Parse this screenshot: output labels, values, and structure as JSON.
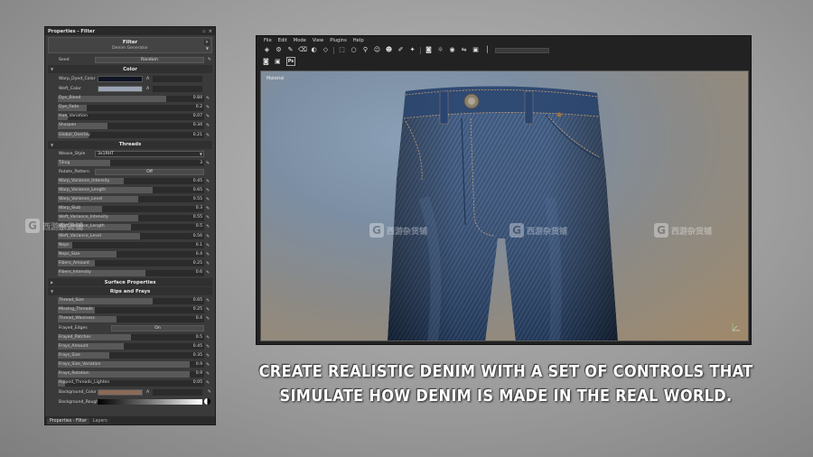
{
  "panel": {
    "title": "Properties - Filter",
    "filter_title": "Filter",
    "filter_name": "Denim Generator",
    "seed_label": "Seed",
    "seed_button": "Random",
    "sections": {
      "color": "Color",
      "threads": "Threads",
      "surface": "Surface Properties",
      "rips": "Rips and Frays"
    },
    "color_rows": [
      {
        "label": "Warp_Dyed_Color",
        "swatch": "#0f1424",
        "alpha": "A"
      },
      {
        "label": "Weft_Color",
        "swatch": "#9aa4b4",
        "alpha": "A"
      }
    ],
    "color_sliders": [
      {
        "label": "Dye_Bleed",
        "value": "0.84",
        "fill": 0.74
      },
      {
        "label": "Dye_Fade",
        "value": "0.2",
        "fill": 0.2
      },
      {
        "label": "Hue_Variation",
        "value": "0.07",
        "fill": 0.07
      },
      {
        "label": "Sharpen",
        "value": "0.34",
        "fill": 0.34
      },
      {
        "label": "Global_Overlay",
        "value": "0.21",
        "fill": 0.21
      }
    ],
    "weave_label": "Weave_Style",
    "weave_value": "3x1RHT",
    "tiling_label": "Tiling",
    "tiling_value": "3",
    "rotate_label": "Rotate_Pattern",
    "rotate_value": "Off",
    "thread_sliders": [
      {
        "label": "Warp_Variance_Intensity",
        "value": "0.45",
        "fill": 0.45
      },
      {
        "label": "Warp_Variance_Length",
        "value": "0.65",
        "fill": 0.65
      },
      {
        "label": "Warp_Variance_Level",
        "value": "0.55",
        "fill": 0.55
      },
      {
        "label": "Warp_Slub",
        "value": "0.3",
        "fill": 0.3
      },
      {
        "label": "Weft_Variance_Intensity",
        "value": "0.55",
        "fill": 0.55
      },
      {
        "label": "Weft_Variance_Length",
        "value": "0.5",
        "fill": 0.5
      },
      {
        "label": "Weft_Variance_Level",
        "value": "0.56",
        "fill": 0.56
      },
      {
        "label": "Neps",
        "value": "0.1",
        "fill": 0.1
      },
      {
        "label": "Neps_Size",
        "value": "0.4",
        "fill": 0.4
      },
      {
        "label": "Fibers_Amount",
        "value": "0.25",
        "fill": 0.25
      },
      {
        "label": "Fibers_Intensity",
        "value": "0.6",
        "fill": 0.6
      }
    ],
    "rip_sliders_a": [
      {
        "label": "Thread_Size",
        "value": "0.65",
        "fill": 0.65
      },
      {
        "label": "Missing_Threads",
        "value": "0.25",
        "fill": 0.25
      },
      {
        "label": "Thread_Waviness",
        "value": "0.4",
        "fill": 0.4
      }
    ],
    "frayed_label": "Frayed_Edges",
    "frayed_value": "On",
    "rip_sliders_b": [
      {
        "label": "Frayed_Patches",
        "value": "0.5",
        "fill": 0.5
      },
      {
        "label": "Frays_Amount",
        "value": "0.45",
        "fill": 0.45
      },
      {
        "label": "Frays_Size",
        "value": "0.35",
        "fill": 0.35
      },
      {
        "label": "Frays_Size_Variation",
        "value": "0.9",
        "fill": 0.9
      },
      {
        "label": "Frays_Rotation",
        "value": "0.9",
        "fill": 0.9
      },
      {
        "label": "Ripped_Threads_Lighten",
        "value": "0.05",
        "fill": 0.05
      }
    ],
    "bg_color_label": "Background_Color",
    "bg_color_swatch": "#8a6a58",
    "bg_color_alpha": "A",
    "bg_rough_label": "Background_Roughness",
    "tabs": [
      "Properties - Filter",
      "Layers"
    ]
  },
  "viewer": {
    "menu": [
      "File",
      "Edit",
      "Mode",
      "View",
      "Plugins",
      "Help"
    ],
    "toolbar_icons": [
      "layers-icon",
      "gear-icon",
      "brush-icon",
      "eraser-icon",
      "fill-icon",
      "shape-icon",
      "selection-icon",
      "lasso-icon",
      "stamp-icon",
      "person-icon",
      "person-add-icon",
      "dropper-icon",
      "wand-icon",
      "camera-icon",
      "light-icon",
      "material-icon",
      "mirror-icon",
      "cube-icon",
      "spacer-icon"
    ],
    "ps_label": "Ps",
    "material_label": "Material"
  },
  "watermark": "西游杂货铺",
  "caption": {
    "line1": "CREATE REALISTIC DENIM WITH A SET OF CONTROLS THAT",
    "line2": "SIMULATE HOW DENIM IS MADE IN THE REAL WORLD."
  }
}
